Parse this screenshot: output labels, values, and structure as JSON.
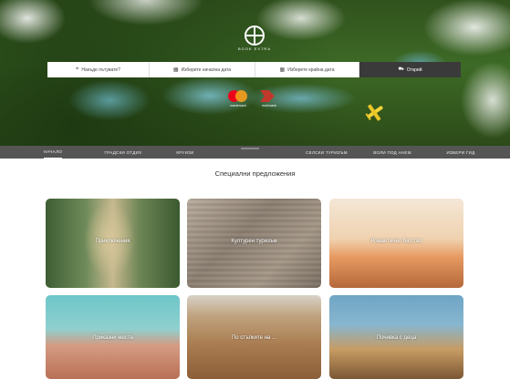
{
  "hero": {
    "logo_text": "BOOK EXTRA",
    "search": {
      "destination_label": "Накъде пътувате?",
      "start_date_label": "Изберете начална дата",
      "end_date_label": "Изберете крайна дата",
      "button_label": "Открий"
    },
    "payments": {
      "mastercard_text": "mastercard",
      "second_text": "mobi.bank"
    }
  },
  "nav": {
    "items": [
      {
        "label": "НАЧАЛО",
        "active": true
      },
      {
        "label": "ГРАДСКИ ОТДИХ"
      },
      {
        "label": "КРУИЗИ"
      },
      {
        "label": "СЕЛСКИ ТУРИЗЪМ"
      },
      {
        "label": "ВОЛИ ПОД НАЕМ"
      },
      {
        "label": "ИЗБЕРИ ГИД"
      }
    ]
  },
  "section": {
    "title": "Специални предложения",
    "cards": [
      {
        "label": "Приключения"
      },
      {
        "label": "Културен туризъм"
      },
      {
        "label": "Романтично бягство"
      },
      {
        "label": "Приказни места"
      },
      {
        "label": "По стъпките на ..."
      },
      {
        "label": "Почивка с деца"
      }
    ]
  }
}
